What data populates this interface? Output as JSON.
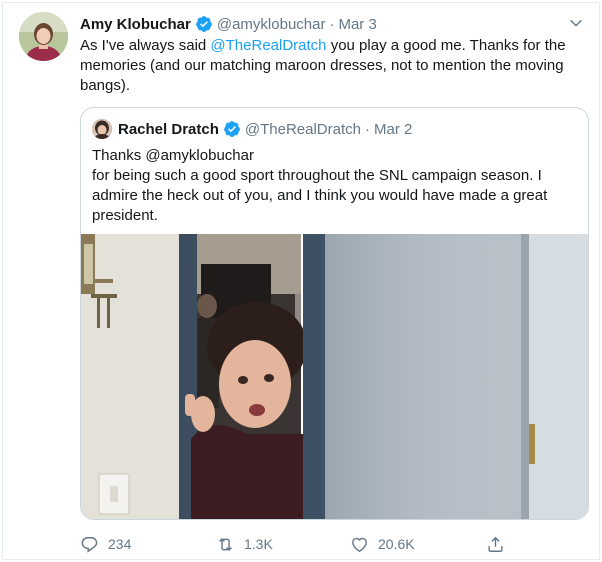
{
  "tweet": {
    "author_name": "Amy Klobuchar",
    "handle": "@amyklobuchar",
    "separator": "·",
    "date": "Mar 3",
    "text_before": "As I've always said ",
    "mention": "@TheRealDratch",
    "text_after": " you play a good me. Thanks for the memories (and our matching maroon dresses, not to mention the moving bangs).",
    "verified_icon": "verified-badge-icon",
    "menu_icon": "chevron-down-icon"
  },
  "quoted": {
    "author_name": "Rachel Dratch",
    "handle": "@TheRealDratch",
    "separator": "·",
    "date": "Mar 2",
    "line1": "Thanks @amyklobuchar",
    "line2": "for being such a good sport throughout the SNL campaign season. I admire the heck out of you, and I think you would have made a great president."
  },
  "actions": {
    "replies": "234",
    "retweets": "1.3K",
    "likes": "20.6K"
  },
  "colors": {
    "accent": "#1da1f2",
    "secondary_text": "#657786",
    "border": "#e6ecf0"
  }
}
